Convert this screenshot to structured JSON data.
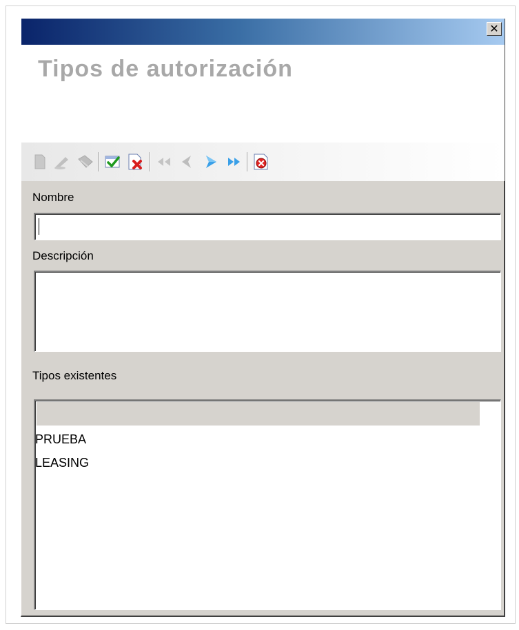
{
  "window": {
    "close_glyph": "✕"
  },
  "header": {
    "title": "Tipos de autorización"
  },
  "toolbar": {
    "buttons": [
      {
        "name": "new-icon",
        "enabled": false
      },
      {
        "name": "edit-icon",
        "enabled": false
      },
      {
        "name": "delete-icon",
        "enabled": false
      },
      {
        "name": "accept-icon",
        "enabled": true
      },
      {
        "name": "cancel-icon",
        "enabled": true
      },
      {
        "name": "first-record-icon",
        "enabled": false
      },
      {
        "name": "previous-record-icon",
        "enabled": false
      },
      {
        "name": "next-record-icon",
        "enabled": true
      },
      {
        "name": "last-record-icon",
        "enabled": true
      },
      {
        "name": "close-form-icon",
        "enabled": true
      }
    ]
  },
  "form": {
    "nombre_label": "Nombre",
    "nombre_value": "",
    "descripcion_label": "Descripción",
    "descripcion_value": "",
    "tipos_label": "Tipos existentes"
  },
  "list": {
    "items": [
      "PRUEBA",
      "LEASING"
    ]
  }
}
